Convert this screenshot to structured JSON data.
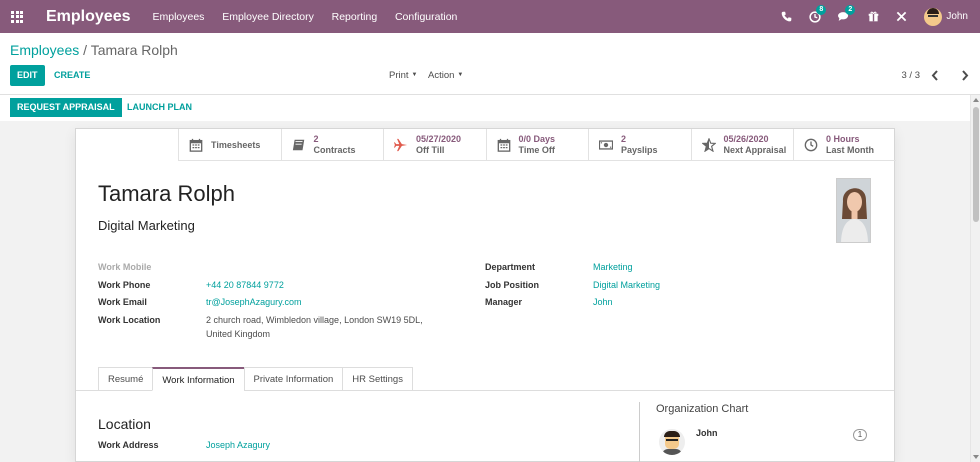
{
  "topnav": {
    "app_title": "Employees",
    "menu": [
      "Employees",
      "Employee Directory",
      "Reporting",
      "Configuration"
    ],
    "activity_count": "8",
    "messages_count": "2",
    "user_name": "John",
    "bg_color": "#875a7b"
  },
  "breadcrumb": {
    "parent": "Employees",
    "separator": "/",
    "current": "Tamara Rolph"
  },
  "control": {
    "edit": "EDIT",
    "create": "CREATE",
    "print": "Print",
    "action": "Action",
    "pager": "3 / 3"
  },
  "statusbar": {
    "request_appraisal": "REQUEST APPRAISAL",
    "launch_plan": "LAUNCH PLAN"
  },
  "smart_buttons": [
    {
      "icon": "calendar-icon",
      "value": "",
      "label": "Timesheets"
    },
    {
      "icon": "book-icon",
      "value": "2",
      "label": "Contracts"
    },
    {
      "icon": "plane-icon",
      "value": "05/27/2020",
      "label": "Off Till"
    },
    {
      "icon": "calendar-icon",
      "value": "0/0 Days",
      "label": "Time Off"
    },
    {
      "icon": "money-icon",
      "value": "2",
      "label": "Payslips"
    },
    {
      "icon": "star-half-icon",
      "value": "05/26/2020",
      "label": "Next Appraisal"
    },
    {
      "icon": "clock-icon",
      "value": "0 Hours",
      "label": "Last Month"
    }
  ],
  "employee": {
    "name": "Tamara Rolph",
    "job_title": "Digital Marketing",
    "work_mobile_label": "Work Mobile",
    "work_phone_label": "Work Phone",
    "work_phone": "+44 20 87844 9772",
    "work_email_label": "Work Email",
    "work_email": "tr@JosephAzagury.com",
    "work_location_label": "Work Location",
    "work_location_line1": "2 church road, Wimbledon village, London SW19 5DL,",
    "work_location_line2": "United Kingdom",
    "department_label": "Department",
    "department": "Marketing",
    "job_position_label": "Job Position",
    "job_position": "Digital Marketing",
    "manager_label": "Manager",
    "manager": "John"
  },
  "tabs": [
    "Resumé",
    "Work Information",
    "Private Information",
    "HR Settings"
  ],
  "work_info": {
    "location_title": "Location",
    "work_address_label": "Work Address",
    "work_address": "Joseph Azagury"
  },
  "org_chart": {
    "title": "Organization Chart",
    "name": "John",
    "count": "1"
  }
}
